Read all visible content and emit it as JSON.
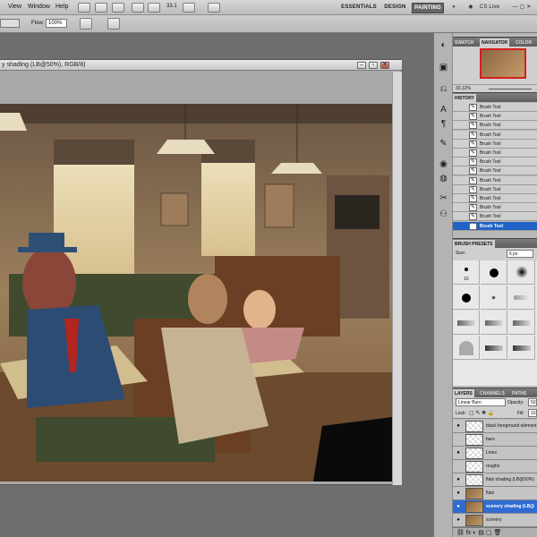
{
  "menubar": {
    "items": [
      "View",
      "Window",
      "Help"
    ],
    "zoom": "33.1",
    "cs_live": "CS Live",
    "workspaces": [
      "ESSENTIALS",
      "DESIGN",
      "PAINTING"
    ],
    "more": "»"
  },
  "options": {
    "flow_label": "Flow:",
    "flow_value": "100%"
  },
  "document": {
    "title": "y shading (LB@50%), RGB/8)"
  },
  "navigator": {
    "tabs": [
      "SWATCH",
      "NAVIGATOR",
      "COLOR"
    ],
    "zoom": "33.12%"
  },
  "history": {
    "title": "HISTORY",
    "items": [
      "Brush Tool",
      "Brush Tool",
      "Brush Tool",
      "Brush Tool",
      "Brush Tool",
      "Brush Tool",
      "Brush Tool",
      "Brush Tool",
      "Brush Tool",
      "Brush Tool",
      "Brush Tool",
      "Brush Tool",
      "Brush Tool",
      "Brush Tool"
    ]
  },
  "brush_presets": {
    "title": "BRUSH PRESETS",
    "size_label": "Size:",
    "size_value": "6 px",
    "first_tip_size": "10"
  },
  "layers": {
    "tabs": [
      "LAYERS",
      "CHANNELS",
      "PATHS"
    ],
    "blend_mode": "Linear Burn",
    "opacity_label": "Opacity:",
    "opacity_value": "50",
    "lock_label": "Lock:",
    "fill_label": "Fill:",
    "fill_value": "10",
    "items": [
      "black foreground element",
      "bars",
      "Lines",
      "roughs",
      "flats shading (LB@50%)",
      "flats",
      "scenery shading (LB@",
      "scenery"
    ],
    "selected_index": 6
  },
  "colors": {
    "selection": "#2f6bd1",
    "history_selection": "#1f63c6",
    "painting_active": "#666666"
  }
}
